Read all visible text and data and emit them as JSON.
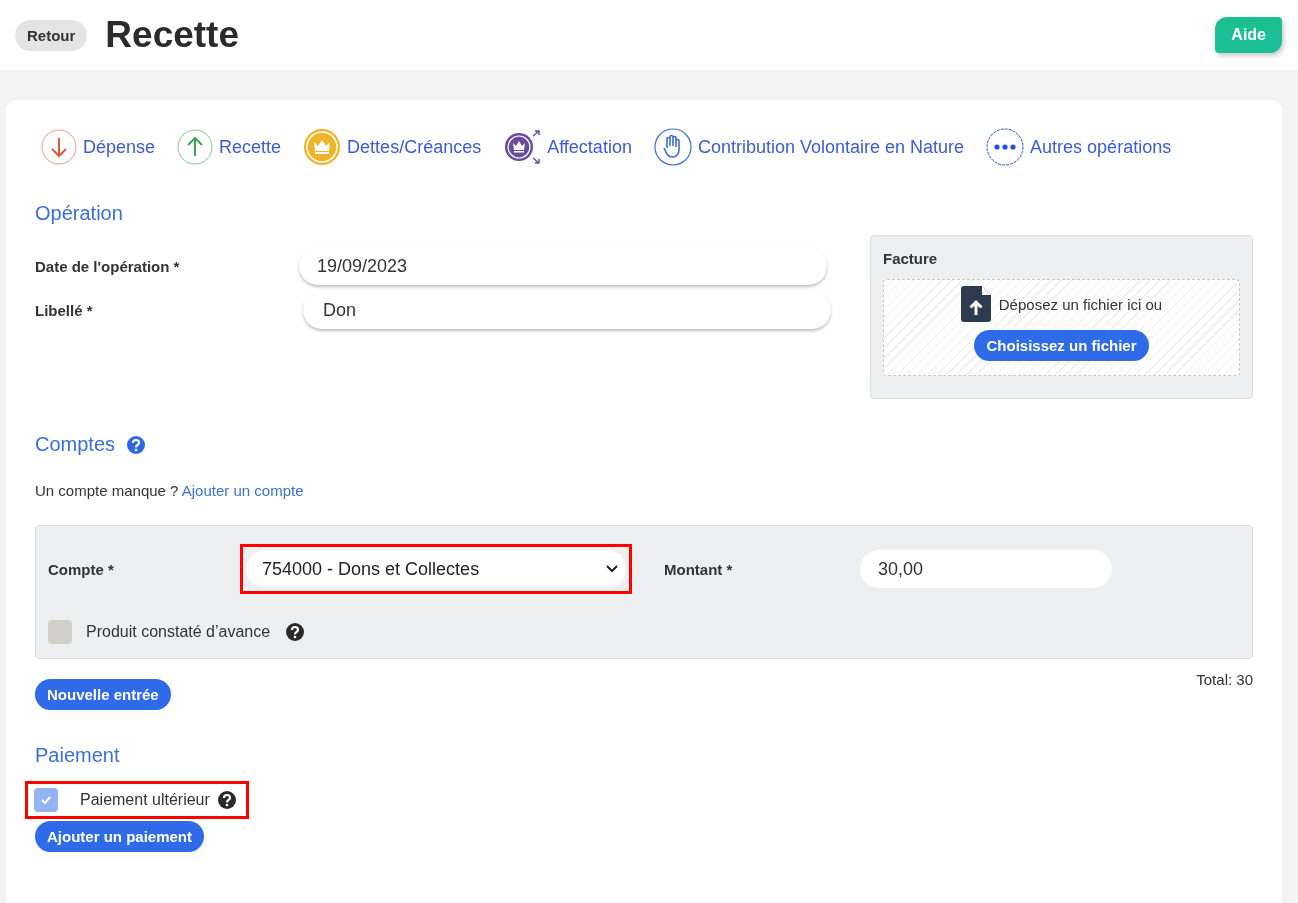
{
  "header": {
    "back_button": "Retour",
    "title": "Recette",
    "help_button": "Aide"
  },
  "operation_types": [
    {
      "kind": "down",
      "label": "Dépense"
    },
    {
      "kind": "up",
      "label": "Recette"
    },
    {
      "kind": "crown",
      "label": "Dettes/Créances"
    },
    {
      "kind": "transfer",
      "label": "Affectation"
    },
    {
      "kind": "hand",
      "label": "Contribution Volontaire en Nature"
    },
    {
      "kind": "dots",
      "label": "Autres opérations"
    }
  ],
  "operation": {
    "heading": "Opération",
    "fields": [
      {
        "label": "Date de l'opération *",
        "value": "19/09/2023"
      },
      {
        "label": "Libellé *",
        "value": "Don"
      }
    ],
    "invoice": {
      "title": "Facture",
      "drop_text": "Déposez un fichier ici ou",
      "button": "Choisissez un fichier"
    }
  },
  "accounts": {
    "heading": "Comptes",
    "missing_text": "Un compte manque ?",
    "missing_link": "Ajouter un compte",
    "entry": {
      "account_label": "Compte *",
      "account_value": "754000 - Dons et Collectes",
      "account_highlighted": true,
      "amount_label": "Montant *",
      "amount_value": "30,00",
      "prepaid_label": "Produit constaté d’avance",
      "prepaid_checked": false
    },
    "new_entry_button": "Nouvelle entrée",
    "total": "Total: 30"
  },
  "payment": {
    "heading": "Paiement",
    "later_label": "Paiement ultérieur",
    "later_checked": true,
    "later_highlighted": true,
    "add_button": "Ajouter un paiement"
  }
}
